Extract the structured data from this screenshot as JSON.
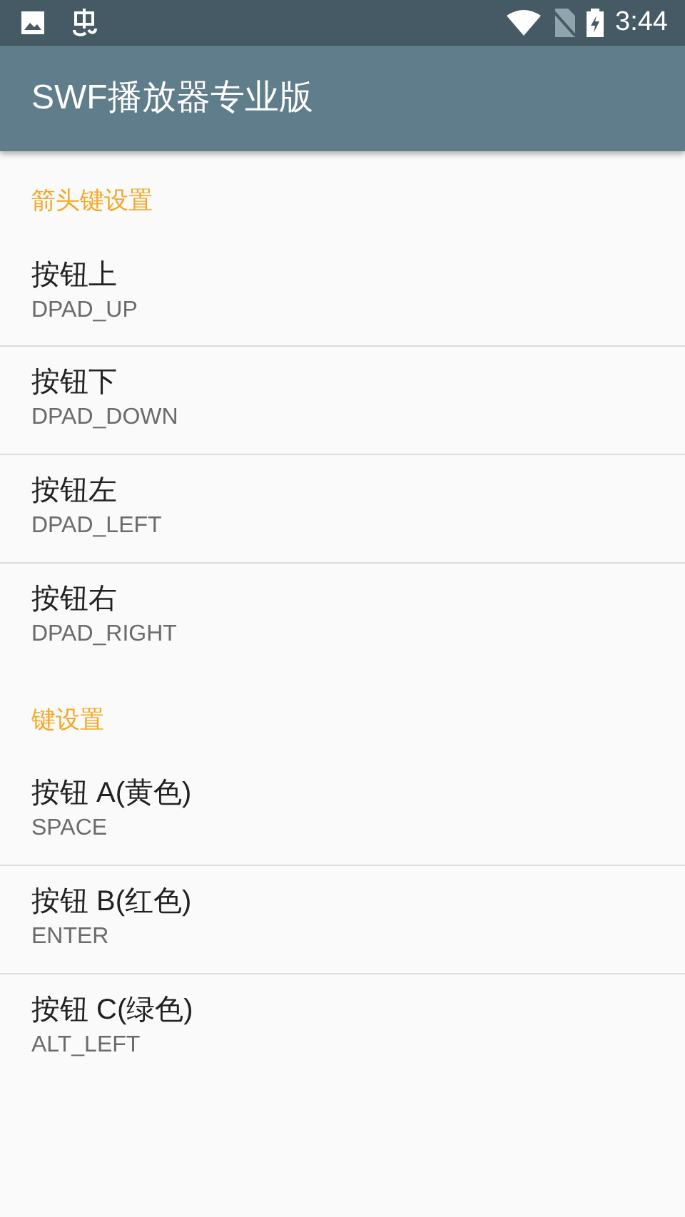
{
  "status_bar": {
    "time": "3:44"
  },
  "app_bar": {
    "title": "SWF播放器专业版"
  },
  "sections": [
    {
      "title": "箭头键设置",
      "items": [
        {
          "title": "按钮上",
          "summary": "DPAD_UP"
        },
        {
          "title": "按钮下",
          "summary": "DPAD_DOWN"
        },
        {
          "title": "按钮左",
          "summary": "DPAD_LEFT"
        },
        {
          "title": "按钮右",
          "summary": "DPAD_RIGHT"
        }
      ]
    },
    {
      "title": "键设置",
      "items": [
        {
          "title": "按钮 A(黄色)",
          "summary": "SPACE"
        },
        {
          "title": "按钮 B(红色)",
          "summary": "ENTER"
        },
        {
          "title": "按钮 C(绿色)",
          "summary": "ALT_LEFT"
        }
      ]
    }
  ]
}
